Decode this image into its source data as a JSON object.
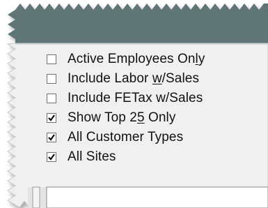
{
  "panel": {
    "header_color": "#5f7476",
    "body_color": "#f0f0f0"
  },
  "options": [
    {
      "id": "active-employees-only",
      "pre": "Active Employees On",
      "accel": "l",
      "post": "y",
      "checked": false
    },
    {
      "id": "include-labor-w-sales",
      "pre": "Include Labor ",
      "accel": "w",
      "post": "/Sales",
      "checked": false
    },
    {
      "id": "include-fetax-w-sales",
      "pre": "Include FETax w/Sales",
      "accel": "",
      "post": "",
      "checked": false
    },
    {
      "id": "show-top-25-only",
      "pre": "Show Top 2",
      "accel": "5",
      "post": " Only",
      "checked": true
    },
    {
      "id": "all-customer-types",
      "pre": "All Customer Types",
      "accel": "",
      "post": "",
      "checked": true
    },
    {
      "id": "all-sites",
      "pre": "All Sites",
      "accel": "",
      "post": "",
      "checked": true
    }
  ],
  "icons": {
    "checkmark": "checkmark-icon"
  }
}
